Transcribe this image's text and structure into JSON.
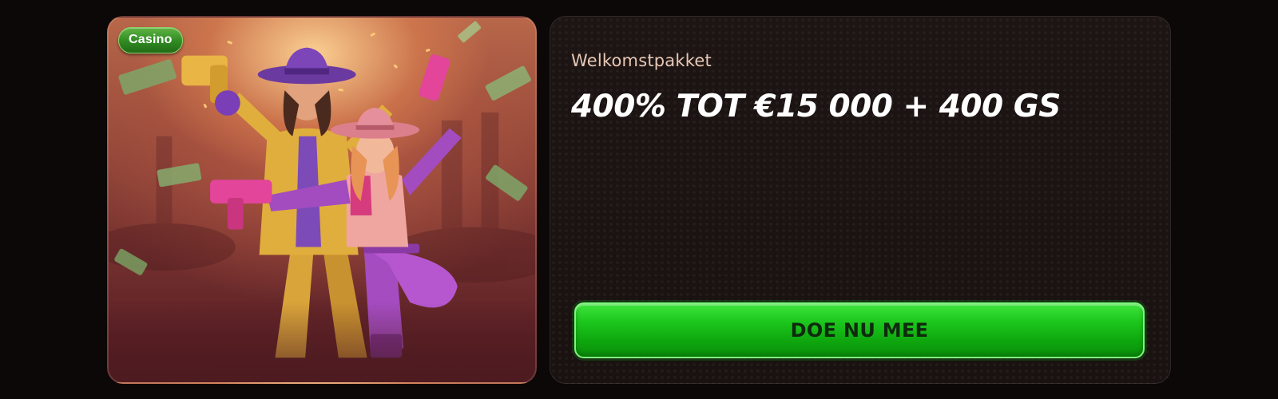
{
  "promo": {
    "badge_label": "Casino",
    "image_icon": "casino-cowboys-illustration",
    "colors": {
      "badge_green": "#2f8a22",
      "card_glow": "#ffd696",
      "card_base": "#7a3430"
    }
  },
  "offer": {
    "subtitle": "Welkomstpakket",
    "headline": "400% TOT €15 000 + 400 GS",
    "cta_label": "DOE NU MEE",
    "colors": {
      "cta_green": "#1cc61c",
      "cta_text": "#0f2a0f",
      "card_background": "#1b1311",
      "subtitle_text": "#e7c7b6"
    }
  }
}
